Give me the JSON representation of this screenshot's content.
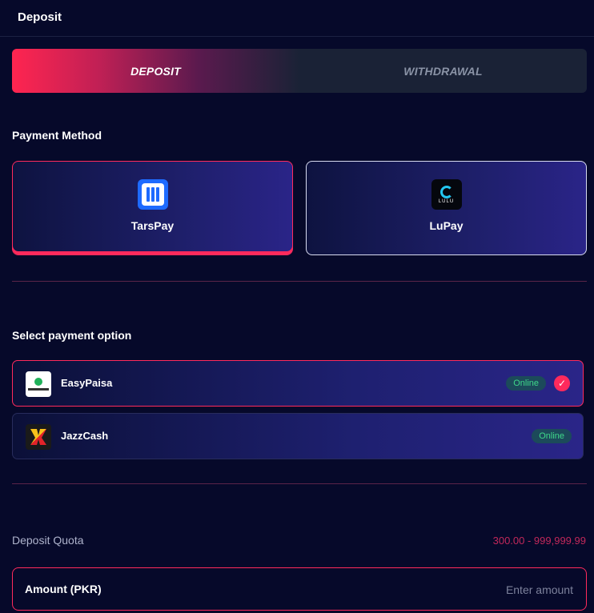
{
  "header": {
    "title": "Deposit"
  },
  "tabs": [
    {
      "label": "DEPOSIT",
      "active": true
    },
    {
      "label": "WITHDRAWAL",
      "active": false
    }
  ],
  "payment_method": {
    "label": "Payment Method",
    "methods": [
      {
        "name": "TarsPay",
        "selected": true
      },
      {
        "name": "LuPay",
        "selected": false,
        "logo_text": "LULU"
      }
    ]
  },
  "payment_option": {
    "label": "Select payment option",
    "options": [
      {
        "name": "EasyPaisa",
        "status": "Online",
        "selected": true
      },
      {
        "name": "JazzCash",
        "status": "Online",
        "selected": false
      }
    ]
  },
  "quota": {
    "label": "Deposit Quota",
    "value": "300.00 - 999,999.99"
  },
  "amount": {
    "label": "Amount (PKR)",
    "placeholder": "Enter amount"
  },
  "colors": {
    "accent": "#ff2a5c",
    "background": "#06092a",
    "online": "#3fd98a"
  }
}
